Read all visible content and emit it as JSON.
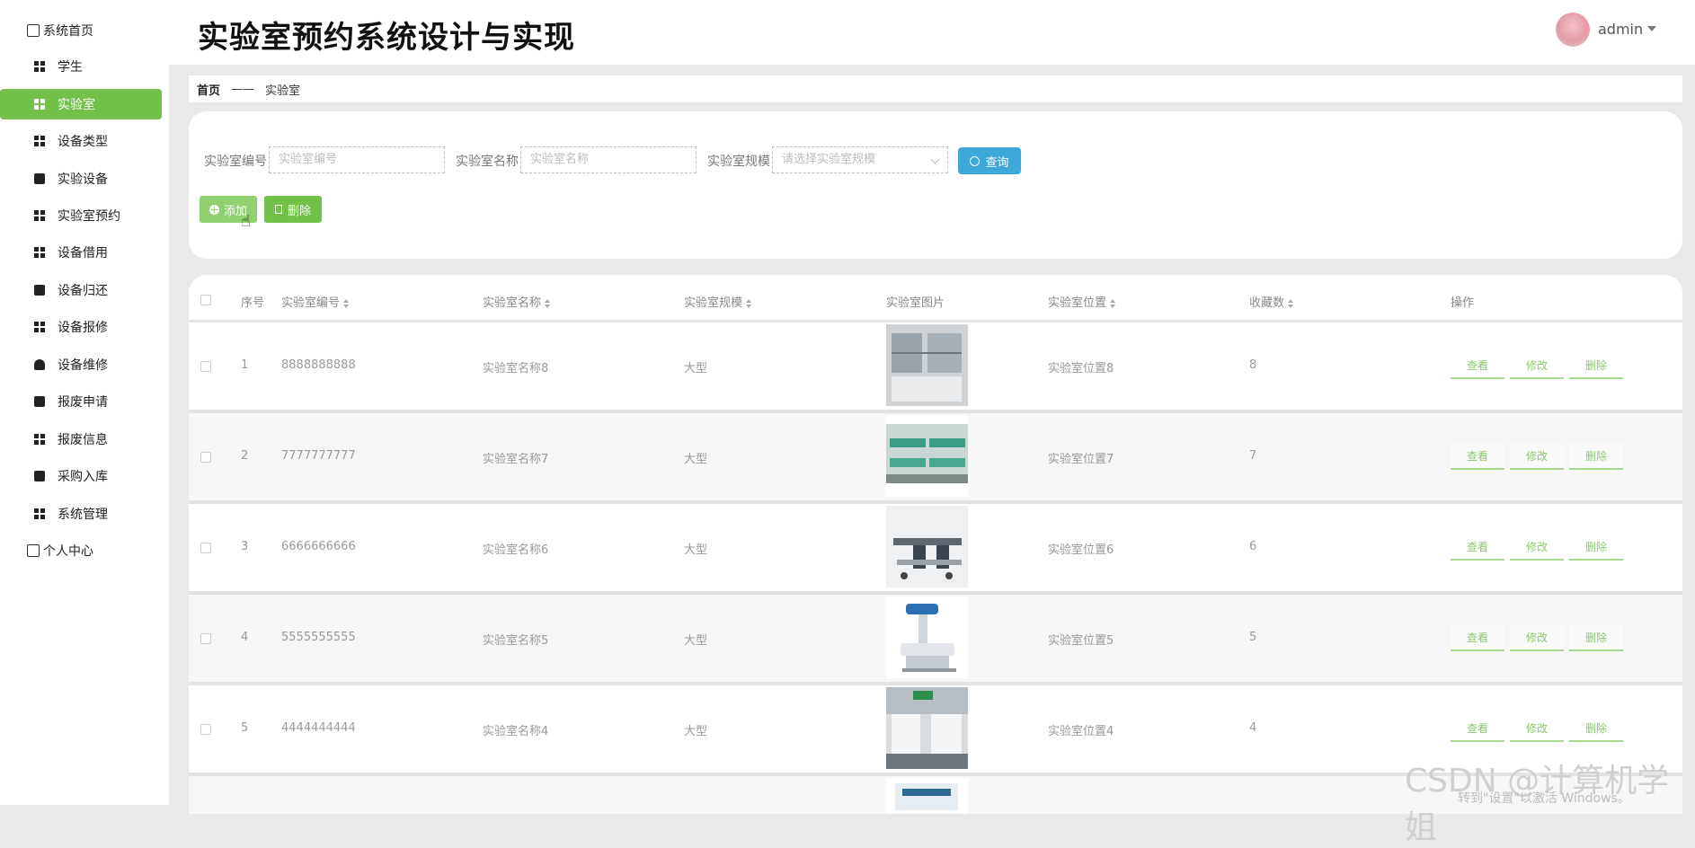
{
  "sidebar": {
    "items": [
      {
        "label": "系统首页",
        "icon": "home-icon"
      },
      {
        "label": "学生",
        "icon": "grid-icon"
      },
      {
        "label": "实验室",
        "icon": "grid-icon",
        "active": true
      },
      {
        "label": "设备类型",
        "icon": "grid-icon"
      },
      {
        "label": "实验设备",
        "icon": "device-icon"
      },
      {
        "label": "实验室预约",
        "icon": "grid-icon"
      },
      {
        "label": "设备借用",
        "icon": "grid-icon"
      },
      {
        "label": "设备归还",
        "icon": "briefcase-icon"
      },
      {
        "label": "设备报修",
        "icon": "grid-icon"
      },
      {
        "label": "设备维修",
        "icon": "user-icon"
      },
      {
        "label": "报废申请",
        "icon": "clipboard-icon"
      },
      {
        "label": "报废信息",
        "icon": "grid-icon"
      },
      {
        "label": "采购入库",
        "icon": "wallet-icon"
      },
      {
        "label": "系统管理",
        "icon": "grid-icon"
      },
      {
        "label": "个人中心",
        "icon": "card-icon"
      }
    ]
  },
  "header": {
    "title": "实验室预约系统设计与实现",
    "user": "admin"
  },
  "breadcrumb": {
    "home": "首页",
    "separator": "——",
    "current": "实验室"
  },
  "search": {
    "code_label": "实验室编号",
    "code_placeholder": "实验室编号",
    "name_label": "实验室名称",
    "name_placeholder": "实验室名称",
    "scale_label": "实验室规模",
    "scale_placeholder": "请选择实验室规模",
    "query_label": "查询",
    "add_label": "添加",
    "delete_label": "删除"
  },
  "table": {
    "headers": {
      "index": "序号",
      "code": "实验室编号",
      "name": "实验室名称",
      "scale": "实验室规模",
      "image": "实验室图片",
      "location": "实验室位置",
      "favorites": "收藏数",
      "actions": "操作"
    },
    "actions": {
      "view": "查看",
      "edit": "修改",
      "delete": "删除"
    },
    "rows": [
      {
        "index": "1",
        "code": "8888888888",
        "name": "实验室名称8",
        "scale": "大型",
        "location": "实验室位置8",
        "favorites": "8"
      },
      {
        "index": "2",
        "code": "7777777777",
        "name": "实验室名称7",
        "scale": "大型",
        "location": "实验室位置7",
        "favorites": "7"
      },
      {
        "index": "3",
        "code": "6666666666",
        "name": "实验室名称6",
        "scale": "大型",
        "location": "实验室位置6",
        "favorites": "6"
      },
      {
        "index": "4",
        "code": "5555555555",
        "name": "实验室名称5",
        "scale": "大型",
        "location": "实验室位置5",
        "favorites": "5"
      },
      {
        "index": "5",
        "code": "4444444444",
        "name": "实验室名称4",
        "scale": "大型",
        "location": "实验室位置4",
        "favorites": "4"
      }
    ]
  },
  "watermark": {
    "main": "CSDN @计算机学姐",
    "sub": "转到\"设置\"以激活 Windows。"
  },
  "colors": {
    "accent_green": "#72c24a",
    "query_blue": "#3ea9d8",
    "action_green": "#8cc76d"
  }
}
